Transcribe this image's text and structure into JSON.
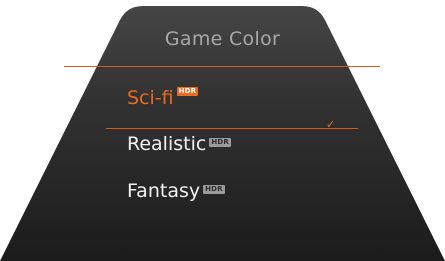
{
  "panel": {
    "title": "Game Color"
  },
  "menu": {
    "items": [
      {
        "label": "Sci-fi",
        "badge": "HDR",
        "selected": true
      },
      {
        "label": "Realistic",
        "badge": "HDR",
        "selected": false
      },
      {
        "label": "Fantasy",
        "badge": "HDR",
        "selected": false
      }
    ],
    "check_glyph": "✓"
  },
  "colors": {
    "accent": "#ec6a22",
    "panel_top": "#444444",
    "panel_bottom": "#1c1c1c",
    "title_text": "#a8a8a8",
    "item_text": "#f2f2f2"
  }
}
